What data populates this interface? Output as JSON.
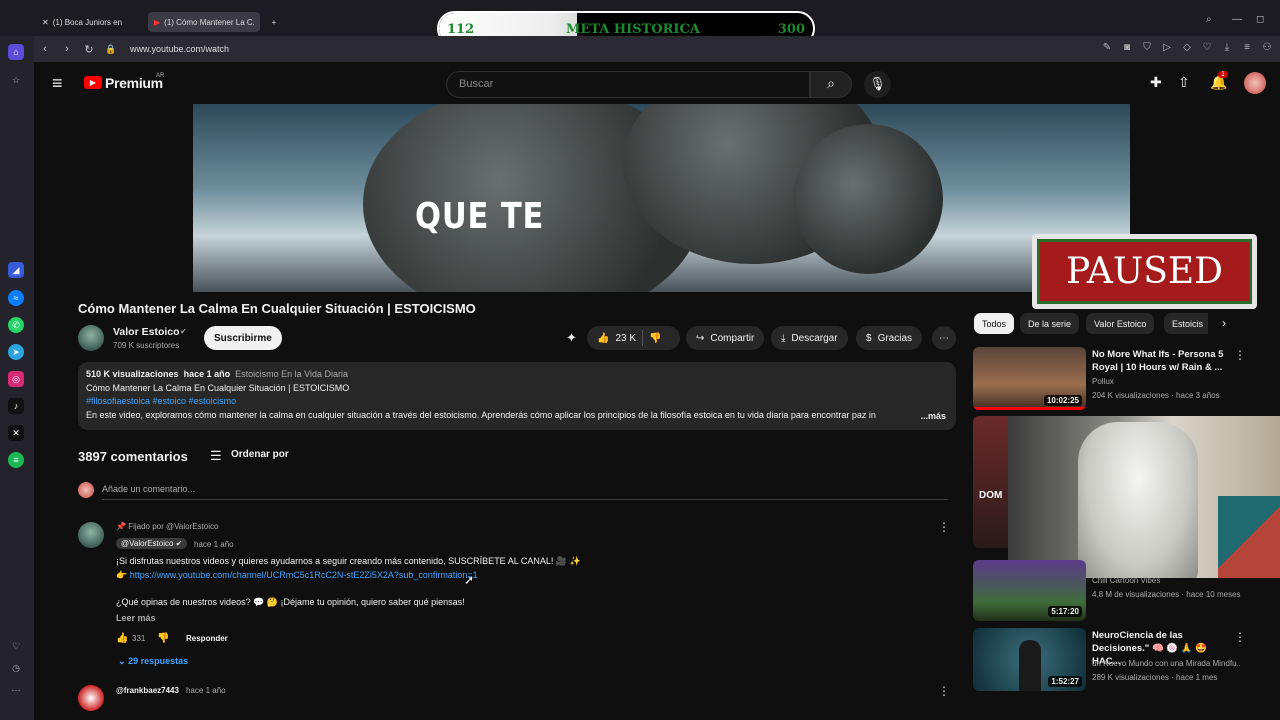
{
  "browser": {
    "tabs": [
      "(1) Boca Juniors en X",
      "(1) Cómo Mantener La C..."
    ],
    "url": "www.youtube.com/watch"
  },
  "stream_widget": {
    "current": "112",
    "label": "META HISTORICA",
    "goal": "300",
    "progress": 0.37
  },
  "header": {
    "logo": "Premium",
    "region": "AR",
    "search_placeholder": "Buscar",
    "notifications_count": "1"
  },
  "video": {
    "caption": "QUE TE",
    "overlay": "PAUSED",
    "title": "Cómo Mantener La Calma En Cualquier Situación | ESTOICISMO"
  },
  "channel": {
    "name": "Valor Estoico",
    "subscribers": "709 K suscriptores",
    "subscribe_label": "Suscribirme"
  },
  "actions": {
    "likes": "23 K",
    "share": "Compartir",
    "download": "Descargar",
    "thanks": "Gracias"
  },
  "description": {
    "views": "510 K visualizaciones",
    "age": "hace 1 año",
    "playlist": "Estoicismo En la Vida Diaria",
    "line2": "Cómo Mantener La Calma En Cualquier Situación | ESTOICISMO",
    "hashtags": "#filosofiaestoica  #estoico  #estoicismo",
    "text": "En este video, exploramos cómo mantener la calma en cualquier situación a través del estoicismo. Aprenderás cómo aplicar los principios de la filosofía estoica en tu vida diaria para encontrar paz in",
    "more": "...más"
  },
  "comments": {
    "count": "3897 comentarios",
    "sort": "Ordenar por",
    "add_placeholder": "Añade un comentario...",
    "pinned": {
      "pinned_by": "Fijado por @ValorEstoico",
      "author": "@ValorEstoico",
      "age": "hace 1 año",
      "line1": "¡Si disfrutas nuestros videos y quieres ayudarnos a seguir creando más contenido, SUSCRÍBETE AL CANAL! 🎥 ✨",
      "link_prefix": "👉",
      "link": "https://www.youtube.com/channel/UCRmC5c1RcC2N-stE2Zi5X2A?sub_confirmation=1",
      "line3": "¿Qué opinas de nuestros videos? 💬 🤔 ¡Déjame tu opinión, quiero saber qué piensas!",
      "read_more": "Leer más",
      "likes": "331",
      "reply": "Responder",
      "replies": "29 respuestas"
    },
    "second": {
      "author": "@frankbaez7443",
      "age": "hace 1 año"
    }
  },
  "chips": [
    "Todos",
    "De la serie",
    "Valor Estoico",
    "Estoicis"
  ],
  "recommendations": [
    {
      "title": "No More What Ifs - Persona 5 Royal | 10 Hours w/ Rain & ...",
      "channel": "Pollux",
      "meta": "204 K visualizaciones · hace 3 años",
      "duration": "10:02:25"
    },
    {
      "title": "",
      "channel": "Chill Cartoon Vibes",
      "meta": "4,8 M de visualizaciones · hace 10 meses",
      "duration": "5:17:20"
    },
    {
      "title": "NeuroCiencia de las Decisiones.\" 🧠 🍥 🙏 🤩 HAC...",
      "channel": "un Nuevo Mundo con una Mirada Mindfu...",
      "meta": "289 K visualizaciones · hace 1 mes",
      "duration": "1:52:27"
    }
  ],
  "partial_thumb_text": "DOM"
}
